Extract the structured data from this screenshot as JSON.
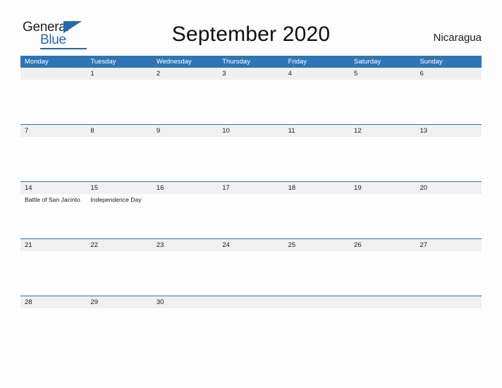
{
  "brand": {
    "name_part1": "General",
    "name_part2": "Blue",
    "triangle_icon": "triangle-icon",
    "color_dark": "#231f20",
    "color_blue": "#1f6cb0"
  },
  "header": {
    "title": "September 2020",
    "country": "Nicaragua"
  },
  "theme": {
    "header_blue": "#2e75b6",
    "row_divider_blue": "#2e75b6",
    "date_band_gray": "#f0f0f0",
    "page_background": "#fdfdfd",
    "text_color": "#1a1a1a"
  },
  "calendar": {
    "month": "September",
    "year": "2020",
    "weekday_headers": [
      "Monday",
      "Tuesday",
      "Wednesday",
      "Thursday",
      "Friday",
      "Saturday",
      "Sunday"
    ],
    "weeks": [
      {
        "days": [
          {
            "date": "",
            "events": []
          },
          {
            "date": "1",
            "events": []
          },
          {
            "date": "2",
            "events": []
          },
          {
            "date": "3",
            "events": []
          },
          {
            "date": "4",
            "events": []
          },
          {
            "date": "5",
            "events": []
          },
          {
            "date": "6",
            "events": []
          }
        ]
      },
      {
        "days": [
          {
            "date": "7",
            "events": []
          },
          {
            "date": "8",
            "events": []
          },
          {
            "date": "9",
            "events": []
          },
          {
            "date": "10",
            "events": []
          },
          {
            "date": "11",
            "events": []
          },
          {
            "date": "12",
            "events": []
          },
          {
            "date": "13",
            "events": []
          }
        ]
      },
      {
        "days": [
          {
            "date": "14",
            "events": [
              "Battle of San Jacinto"
            ]
          },
          {
            "date": "15",
            "events": [
              "Independence Day"
            ]
          },
          {
            "date": "16",
            "events": []
          },
          {
            "date": "17",
            "events": []
          },
          {
            "date": "18",
            "events": []
          },
          {
            "date": "19",
            "events": []
          },
          {
            "date": "20",
            "events": []
          }
        ]
      },
      {
        "days": [
          {
            "date": "21",
            "events": []
          },
          {
            "date": "22",
            "events": []
          },
          {
            "date": "23",
            "events": []
          },
          {
            "date": "24",
            "events": []
          },
          {
            "date": "25",
            "events": []
          },
          {
            "date": "26",
            "events": []
          },
          {
            "date": "27",
            "events": []
          }
        ]
      },
      {
        "days": [
          {
            "date": "28",
            "events": []
          },
          {
            "date": "29",
            "events": []
          },
          {
            "date": "30",
            "events": []
          },
          {
            "date": "",
            "events": []
          },
          {
            "date": "",
            "events": []
          },
          {
            "date": "",
            "events": []
          },
          {
            "date": "",
            "events": []
          }
        ]
      }
    ]
  }
}
